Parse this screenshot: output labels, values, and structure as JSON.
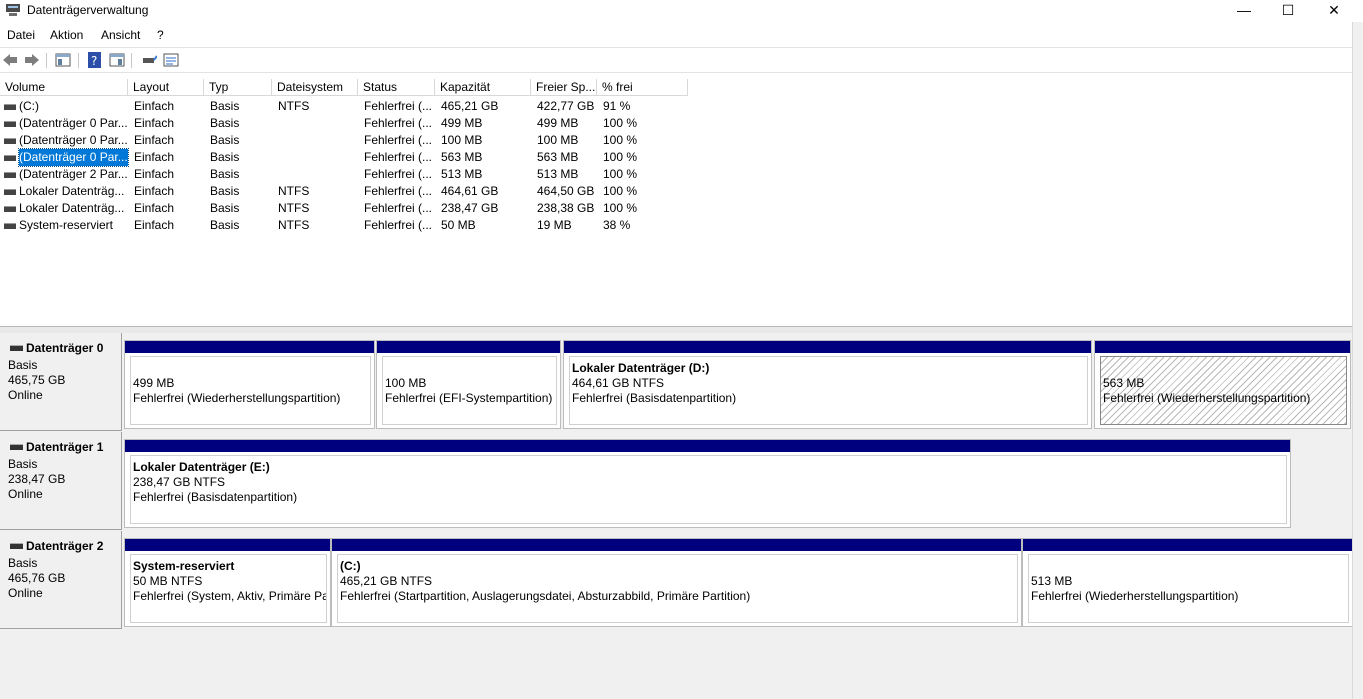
{
  "window": {
    "title": "Datenträgerverwaltung",
    "minimize": "—",
    "maximize": "☐",
    "close": "✕"
  },
  "menu": [
    "Datei",
    "Aktion",
    "Ansicht",
    "?"
  ],
  "toolbar_icons": [
    "back-icon",
    "forward-icon",
    "show-hide-console-tree-icon",
    "help-icon",
    "properties-icon",
    "connect-icon",
    "list-view-icon"
  ],
  "columns": [
    "Volume",
    "Layout",
    "Typ",
    "Dateisystem",
    "Status",
    "Kapazität",
    "Freier Sp...",
    "% frei"
  ],
  "volumes": [
    {
      "volume": " (C:)",
      "layout": "Einfach",
      "typ": "Basis",
      "fs": "NTFS",
      "status": "Fehlerfrei (...",
      "kap": "465,21 GB",
      "frei": "422,77 GB",
      "pct": "91 %"
    },
    {
      "volume": "(Datenträger 0 Par...",
      "layout": "Einfach",
      "typ": "Basis",
      "fs": "",
      "status": "Fehlerfrei (...",
      "kap": "499 MB",
      "frei": "499 MB",
      "pct": "100 %"
    },
    {
      "volume": "(Datenträger 0 Par...",
      "layout": "Einfach",
      "typ": "Basis",
      "fs": "",
      "status": "Fehlerfrei (...",
      "kap": "100 MB",
      "frei": "100 MB",
      "pct": "100 %"
    },
    {
      "volume": "(Datenträger 0 Par...",
      "layout": "Einfach",
      "typ": "Basis",
      "fs": "",
      "status": "Fehlerfrei (...",
      "kap": "563 MB",
      "frei": "563 MB",
      "pct": "100 %",
      "selected": true
    },
    {
      "volume": "(Datenträger 2 Par...",
      "layout": "Einfach",
      "typ": "Basis",
      "fs": "",
      "status": "Fehlerfrei (...",
      "kap": "513 MB",
      "frei": "513 MB",
      "pct": "100 %"
    },
    {
      "volume": "Lokaler Datenträg...",
      "layout": "Einfach",
      "typ": "Basis",
      "fs": "NTFS",
      "status": "Fehlerfrei (...",
      "kap": "464,61 GB",
      "frei": "464,50 GB",
      "pct": "100 %"
    },
    {
      "volume": "Lokaler Datenträg...",
      "layout": "Einfach",
      "typ": "Basis",
      "fs": "NTFS",
      "status": "Fehlerfrei (...",
      "kap": "238,47 GB",
      "frei": "238,38 GB",
      "pct": "100 %"
    },
    {
      "volume": "System-reserviert",
      "layout": "Einfach",
      "typ": "Basis",
      "fs": "NTFS",
      "status": "Fehlerfrei (...",
      "kap": "50 MB",
      "frei": "19 MB",
      "pct": "38 %"
    }
  ],
  "disks": [
    {
      "name": "Datenträger 0",
      "type": "Basis",
      "size": "465,75 GB",
      "state": "Online",
      "partitions": [
        {
          "title": "",
          "line1": "499 MB",
          "line2": "Fehlerfrei (Wiederherstellungspartition)",
          "hatched": false
        },
        {
          "title": "",
          "line1": "100 MB",
          "line2": "Fehlerfrei (EFI-Systempartition)",
          "hatched": false
        },
        {
          "title": "Lokaler Datenträger  (D:)",
          "line1": "464,61 GB NTFS",
          "line2": "Fehlerfrei (Basisdatenpartition)",
          "hatched": false
        },
        {
          "title": "",
          "line1": "563 MB",
          "line2": "Fehlerfrei (Wiederherstellungspartition)",
          "hatched": true
        }
      ]
    },
    {
      "name": "Datenträger 1",
      "type": "Basis",
      "size": "238,47 GB",
      "state": "Online",
      "partitions": [
        {
          "title": "Lokaler Datenträger  (E:)",
          "line1": "238,47 GB NTFS",
          "line2": "Fehlerfrei (Basisdatenpartition)",
          "hatched": false
        }
      ]
    },
    {
      "name": "Datenträger 2",
      "type": "Basis",
      "size": "465,76 GB",
      "state": "Online",
      "partitions": [
        {
          "title": "System-reserviert",
          "line1": "50 MB NTFS",
          "line2": "Fehlerfrei (System, Aktiv, Primäre Partition)",
          "hatched": false
        },
        {
          "title": " (C:)",
          "line1": "465,21 GB NTFS",
          "line2": "Fehlerfrei (Startpartition, Auslagerungsdatei, Absturzabbild, Primäre Partition)",
          "hatched": false
        },
        {
          "title": "",
          "line1": "513 MB",
          "line2": "Fehlerfrei (Wiederherstellungspartition)",
          "hatched": false
        }
      ]
    }
  ]
}
